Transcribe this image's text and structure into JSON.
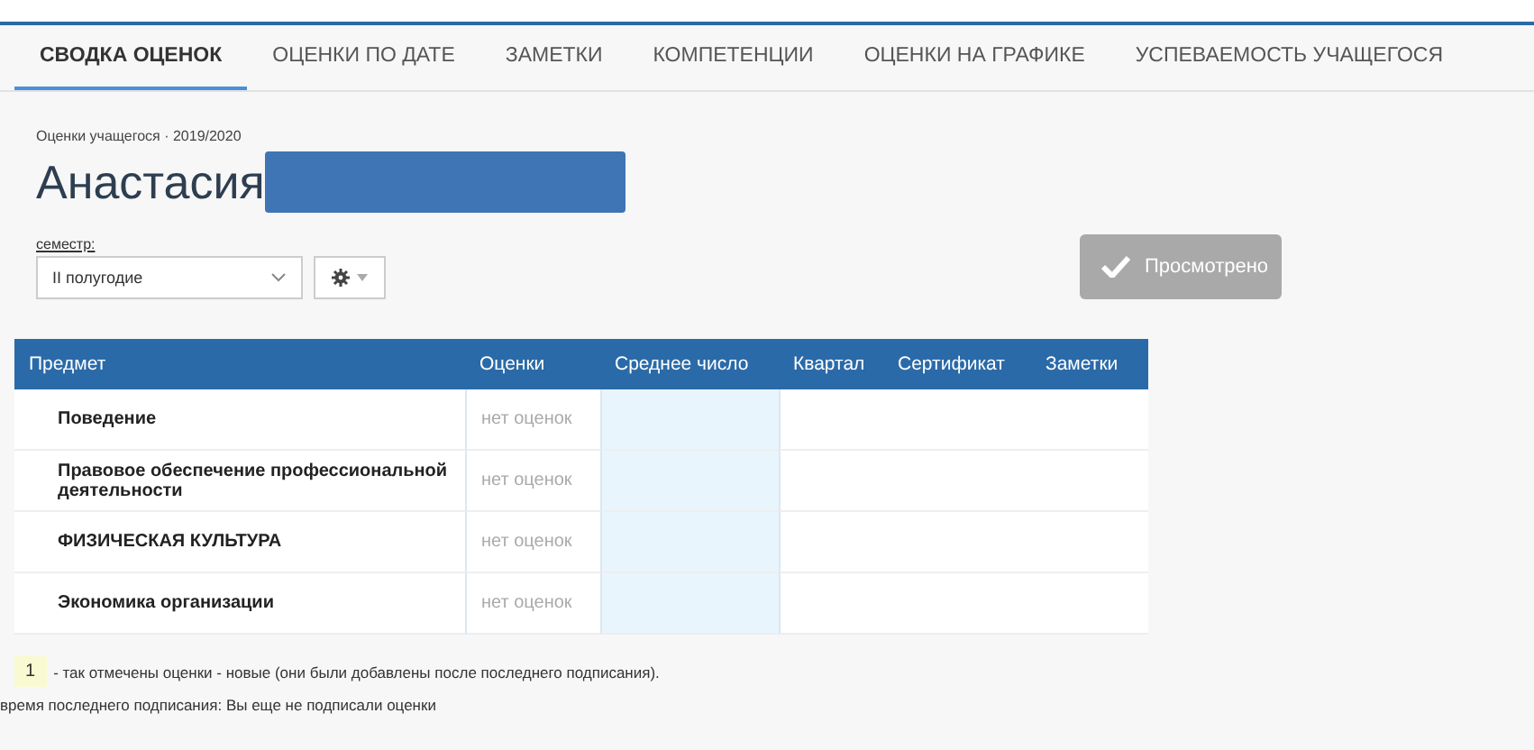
{
  "tabs": [
    {
      "label": "СВОДКА ОЦЕНОК",
      "selected": true
    },
    {
      "label": "ОЦЕНКИ ПО ДАТЕ",
      "selected": false
    },
    {
      "label": "ЗАМЕТКИ",
      "selected": false
    },
    {
      "label": "КОМПЕТЕНЦИИ",
      "selected": false
    },
    {
      "label": "ОЦЕНКИ НА ГРАФИКЕ",
      "selected": false
    },
    {
      "label": "УСПЕВАЕМОСТЬ УЧАЩЕГОСЯ",
      "selected": false
    }
  ],
  "subtitle": "Оценки учащегося · 2019/2020",
  "student_name": "Анастасия",
  "semester": {
    "label": "семестр:",
    "value": "II полугодие"
  },
  "reviewed_button": {
    "label": "Просмотрено",
    "disabled": true
  },
  "table": {
    "columns": [
      "Предмет",
      "Оценки",
      "Среднее число",
      "Квартал",
      "Сертификат",
      "Заметки"
    ],
    "rows": [
      {
        "subject": "Поведение",
        "grades": "нет оценок"
      },
      {
        "subject": "Правовое обеспечение профессиональной деятельности",
        "grades": "нет оценок"
      },
      {
        "subject": "ФИЗИЧЕСКАЯ КУЛЬТУРА",
        "grades": "нет оценок"
      },
      {
        "subject": "Экономика организации",
        "grades": "нет оценок"
      }
    ]
  },
  "legend": {
    "sample": "1",
    "text": "- так отмечены оценки - новые (они были добавлены после последнего подписания)."
  },
  "last_signed": "время последнего подписания: Вы еще не подписали оценки"
}
